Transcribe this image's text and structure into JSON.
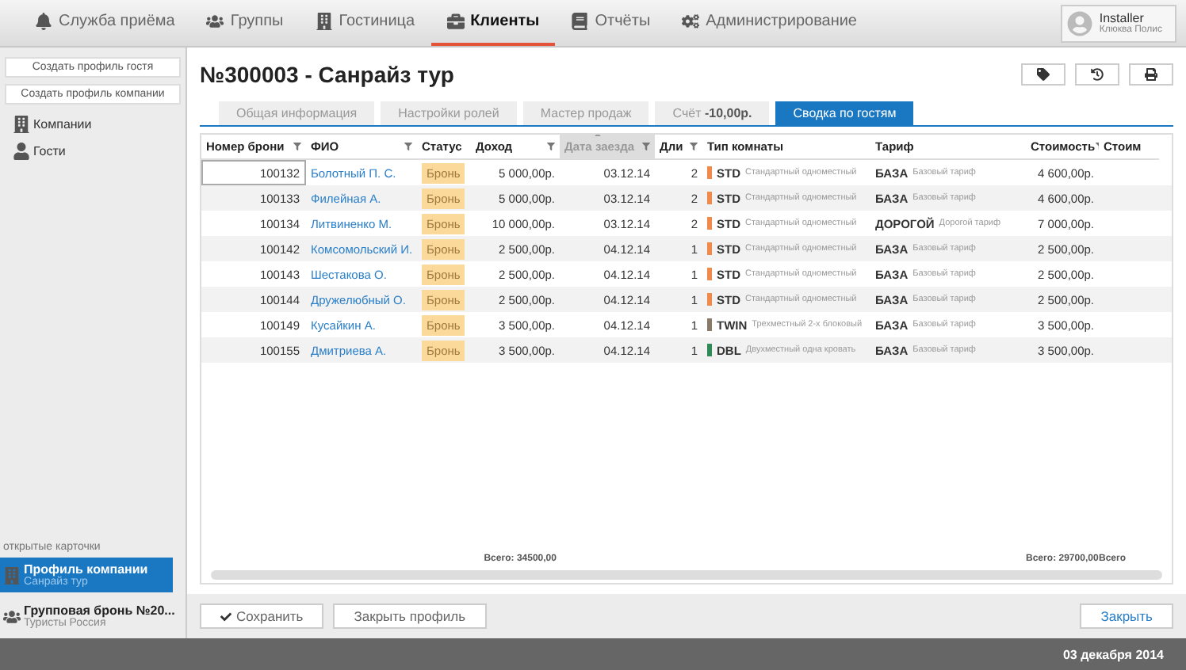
{
  "nav": {
    "items": [
      {
        "label": "Служба приёма",
        "selected": false
      },
      {
        "label": "Группы",
        "selected": false
      },
      {
        "label": "Гостиница",
        "selected": false
      },
      {
        "label": "Клиенты",
        "selected": true
      },
      {
        "label": "Отчёты",
        "selected": false
      },
      {
        "label": "Администрирование",
        "selected": false
      }
    ],
    "user": {
      "name": "Installer",
      "hotel": "Клюква Полис"
    }
  },
  "sidebar": {
    "buttons": [
      "Создать профиль гостя",
      "Создать профиль компании"
    ],
    "items": [
      {
        "label": "Компании"
      },
      {
        "label": "Гости"
      }
    ],
    "open_cards_title": "открытые карточки",
    "open_cards": [
      {
        "title": "Профиль компании",
        "subtitle": "Санрайз тур",
        "selected": true
      },
      {
        "title": "Групповая бронь №20...",
        "subtitle": "Туристы Россия",
        "selected": false
      }
    ]
  },
  "title": "№300003 - Санрайз тур",
  "tabs": [
    {
      "label": "Общая информация",
      "selected": false
    },
    {
      "label": "Настройки ролей",
      "selected": false
    },
    {
      "label": "Мастер продаж",
      "selected": false
    },
    {
      "label": "Счёт",
      "amount": "-10,00р.",
      "selected": false
    },
    {
      "label": "Сводка по гостям",
      "selected": true
    }
  ],
  "table": {
    "columns": [
      {
        "label": "Номер брони",
        "filter": true,
        "sorted": false
      },
      {
        "label": "ФИО",
        "filter": true,
        "sorted": false
      },
      {
        "label": "Статус",
        "filter": false,
        "sorted": false
      },
      {
        "label": "Доход",
        "filter": true,
        "sorted": false
      },
      {
        "label": "Дата заезда",
        "filter": true,
        "sorted": true
      },
      {
        "label": "Дли",
        "filter": true,
        "sorted": false
      },
      {
        "label": "Тип комнаты",
        "filter": false,
        "sorted": false
      },
      {
        "label": "Тариф",
        "filter": false,
        "sorted": false
      },
      {
        "label": "Стоимость",
        "filter": true,
        "sorted": false
      },
      {
        "label": "Стоим",
        "filter": false,
        "sorted": false
      }
    ],
    "rows": [
      {
        "number": "100132",
        "name": "Болотный П. С.",
        "status": "Бронь",
        "income": "5 000,00р.",
        "arrival": "03.12.14",
        "nights": "2",
        "room_code": "STD",
        "color": "#f08a4b",
        "room_desc": "Стандартный одноместный",
        "rate": "БАЗА",
        "rate_desc": "Базовый тариф",
        "cost": "4 600,00р.",
        "focused": true
      },
      {
        "number": "100133",
        "name": "Филейная А.",
        "status": "Бронь",
        "income": "5 000,00р.",
        "arrival": "03.12.14",
        "nights": "2",
        "room_code": "STD",
        "color": "#f08a4b",
        "room_desc": "Стандартный одноместный",
        "rate": "БАЗА",
        "rate_desc": "Базовый тариф",
        "cost": "4 600,00р.",
        "focused": false
      },
      {
        "number": "100134",
        "name": "Литвиненко М.",
        "status": "Бронь",
        "income": "10 000,00р.",
        "arrival": "03.12.14",
        "nights": "2",
        "room_code": "STD",
        "color": "#f08a4b",
        "room_desc": "Стандартный одноместный",
        "rate": "ДОРОГОЙ",
        "rate_desc": "Дорогой тариф",
        "cost": "7 000,00р.",
        "focused": false
      },
      {
        "number": "100142",
        "name": "Комсомольский И.",
        "status": "Бронь",
        "income": "2 500,00р.",
        "arrival": "04.12.14",
        "nights": "1",
        "room_code": "STD",
        "color": "#f08a4b",
        "room_desc": "Стандартный одноместный",
        "rate": "БАЗА",
        "rate_desc": "Базовый тариф",
        "cost": "2 500,00р.",
        "focused": false
      },
      {
        "number": "100143",
        "name": "Шестакова О.",
        "status": "Бронь",
        "income": "2 500,00р.",
        "arrival": "04.12.14",
        "nights": "1",
        "room_code": "STD",
        "color": "#f08a4b",
        "room_desc": "Стандартный одноместный",
        "rate": "БАЗА",
        "rate_desc": "Базовый тариф",
        "cost": "2 500,00р.",
        "focused": false
      },
      {
        "number": "100144",
        "name": "Дружелюбный О.",
        "status": "Бронь",
        "income": "2 500,00р.",
        "arrival": "04.12.14",
        "nights": "1",
        "room_code": "STD",
        "color": "#f08a4b",
        "room_desc": "Стандартный одноместный",
        "rate": "БАЗА",
        "rate_desc": "Базовый тариф",
        "cost": "2 500,00р.",
        "focused": false
      },
      {
        "number": "100149",
        "name": "Кусайкин А.",
        "status": "Бронь",
        "income": "3 500,00р.",
        "arrival": "04.12.14",
        "nights": "1",
        "room_code": "TWIN",
        "color": "#8a7a6a",
        "room_desc": "Трехместный 2-х блоковый",
        "rate": "БАЗА",
        "rate_desc": "Базовый тариф",
        "cost": "3 500,00р.",
        "focused": false
      },
      {
        "number": "100155",
        "name": "Дмитриева А.",
        "status": "Бронь",
        "income": "3 500,00р.",
        "arrival": "04.12.14",
        "nights": "1",
        "room_code": "DBL",
        "color": "#2e8b57",
        "room_desc": "Двухместный одна кровать",
        "rate": "БАЗА",
        "rate_desc": "Базовый тариф",
        "cost": "3 500,00р.",
        "focused": false
      }
    ],
    "totals": {
      "income": "Всего: 34500,00",
      "cost": "Всего: 29700,00",
      "column_10": "Всего"
    }
  },
  "footer_buttons": [
    {
      "label": "Сохранить",
      "kind": "save"
    },
    {
      "label": "Закрыть профиль",
      "kind": "plain"
    },
    {
      "label": "Закрыть",
      "kind": "close"
    }
  ],
  "status_bar": {
    "date": "03 декабря 2014"
  }
}
